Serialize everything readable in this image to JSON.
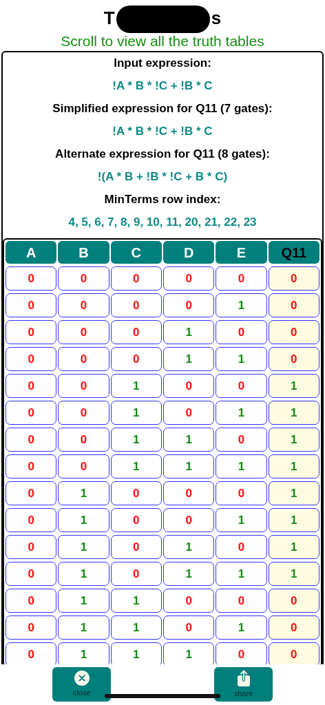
{
  "title": {
    "start": "T",
    "end": "s"
  },
  "subtitle": "Scroll to view all the truth tables",
  "sections": [
    {
      "kind": "heading",
      "text": "Input expression:"
    },
    {
      "kind": "expression",
      "text": "!A * B * !C + !B * C"
    },
    {
      "kind": "heading",
      "text": "Simplified expression for Q11 (7 gates):"
    },
    {
      "kind": "expression",
      "text": "!A * B * !C + !B * C"
    },
    {
      "kind": "heading",
      "text": "Alternate expression for Q11 (8 gates):"
    },
    {
      "kind": "expression",
      "text": "!(A * B + !B * !C + B * C)"
    },
    {
      "kind": "heading",
      "text": "MinTerms row index:"
    },
    {
      "kind": "expression",
      "text": "4, 5, 6, 7, 8, 9, 10, 11, 20, 21, 22, 23"
    }
  ],
  "table": {
    "columns": [
      {
        "label": "A",
        "kind": "input"
      },
      {
        "label": "B",
        "kind": "input"
      },
      {
        "label": "C",
        "kind": "input"
      },
      {
        "label": "D",
        "kind": "input"
      },
      {
        "label": "E",
        "kind": "input"
      },
      {
        "label": "Q11",
        "kind": "output"
      }
    ],
    "rows": [
      [
        {
          "text": "0",
          "on": false
        },
        {
          "text": "0",
          "on": false
        },
        {
          "text": "0",
          "on": false
        },
        {
          "text": "0",
          "on": false
        },
        {
          "text": "0",
          "on": false
        },
        {
          "text": "0",
          "on": false
        }
      ],
      [
        {
          "text": "0",
          "on": false
        },
        {
          "text": "0",
          "on": false
        },
        {
          "text": "0",
          "on": false
        },
        {
          "text": "0",
          "on": false
        },
        {
          "text": "1",
          "on": true
        },
        {
          "text": "0",
          "on": false
        }
      ],
      [
        {
          "text": "0",
          "on": false
        },
        {
          "text": "0",
          "on": false
        },
        {
          "text": "0",
          "on": false
        },
        {
          "text": "1",
          "on": true
        },
        {
          "text": "0",
          "on": false
        },
        {
          "text": "0",
          "on": false
        }
      ],
      [
        {
          "text": "0",
          "on": false
        },
        {
          "text": "0",
          "on": false
        },
        {
          "text": "0",
          "on": false
        },
        {
          "text": "1",
          "on": true
        },
        {
          "text": "1",
          "on": true
        },
        {
          "text": "0",
          "on": false
        }
      ],
      [
        {
          "text": "0",
          "on": false
        },
        {
          "text": "0",
          "on": false
        },
        {
          "text": "1",
          "on": true
        },
        {
          "text": "0",
          "on": false
        },
        {
          "text": "0",
          "on": false
        },
        {
          "text": "1",
          "on": true
        }
      ],
      [
        {
          "text": "0",
          "on": false
        },
        {
          "text": "0",
          "on": false
        },
        {
          "text": "1",
          "on": true
        },
        {
          "text": "0",
          "on": false
        },
        {
          "text": "1",
          "on": true
        },
        {
          "text": "1",
          "on": true
        }
      ],
      [
        {
          "text": "0",
          "on": false
        },
        {
          "text": "0",
          "on": false
        },
        {
          "text": "1",
          "on": true
        },
        {
          "text": "1",
          "on": true
        },
        {
          "text": "0",
          "on": false
        },
        {
          "text": "1",
          "on": true
        }
      ],
      [
        {
          "text": "0",
          "on": false
        },
        {
          "text": "0",
          "on": false
        },
        {
          "text": "1",
          "on": true
        },
        {
          "text": "1",
          "on": true
        },
        {
          "text": "1",
          "on": true
        },
        {
          "text": "1",
          "on": true
        }
      ],
      [
        {
          "text": "0",
          "on": false
        },
        {
          "text": "1",
          "on": true
        },
        {
          "text": "0",
          "on": false
        },
        {
          "text": "0",
          "on": false
        },
        {
          "text": "0",
          "on": false
        },
        {
          "text": "1",
          "on": true
        }
      ],
      [
        {
          "text": "0",
          "on": false
        },
        {
          "text": "1",
          "on": true
        },
        {
          "text": "0",
          "on": false
        },
        {
          "text": "0",
          "on": false
        },
        {
          "text": "1",
          "on": true
        },
        {
          "text": "1",
          "on": true
        }
      ],
      [
        {
          "text": "0",
          "on": false
        },
        {
          "text": "1",
          "on": true
        },
        {
          "text": "0",
          "on": false
        },
        {
          "text": "1",
          "on": true
        },
        {
          "text": "0",
          "on": false
        },
        {
          "text": "1",
          "on": true
        }
      ],
      [
        {
          "text": "0",
          "on": false
        },
        {
          "text": "1",
          "on": true
        },
        {
          "text": "0",
          "on": false
        },
        {
          "text": "1",
          "on": true
        },
        {
          "text": "1",
          "on": true
        },
        {
          "text": "1",
          "on": true
        }
      ],
      [
        {
          "text": "0",
          "on": false
        },
        {
          "text": "1",
          "on": true
        },
        {
          "text": "1",
          "on": true
        },
        {
          "text": "0",
          "on": false
        },
        {
          "text": "0",
          "on": false
        },
        {
          "text": "0",
          "on": false
        }
      ],
      [
        {
          "text": "0",
          "on": false
        },
        {
          "text": "1",
          "on": true
        },
        {
          "text": "1",
          "on": true
        },
        {
          "text": "0",
          "on": false
        },
        {
          "text": "1",
          "on": true
        },
        {
          "text": "0",
          "on": false
        }
      ],
      [
        {
          "text": "0",
          "on": false
        },
        {
          "text": "1",
          "on": true
        },
        {
          "text": "1",
          "on": true
        },
        {
          "text": "1",
          "on": true
        },
        {
          "text": "0",
          "on": false
        },
        {
          "text": "0",
          "on": false
        }
      ]
    ]
  },
  "buttons": [
    {
      "kind": "close",
      "label": "close"
    },
    {
      "kind": "share",
      "label": "share"
    }
  ]
}
